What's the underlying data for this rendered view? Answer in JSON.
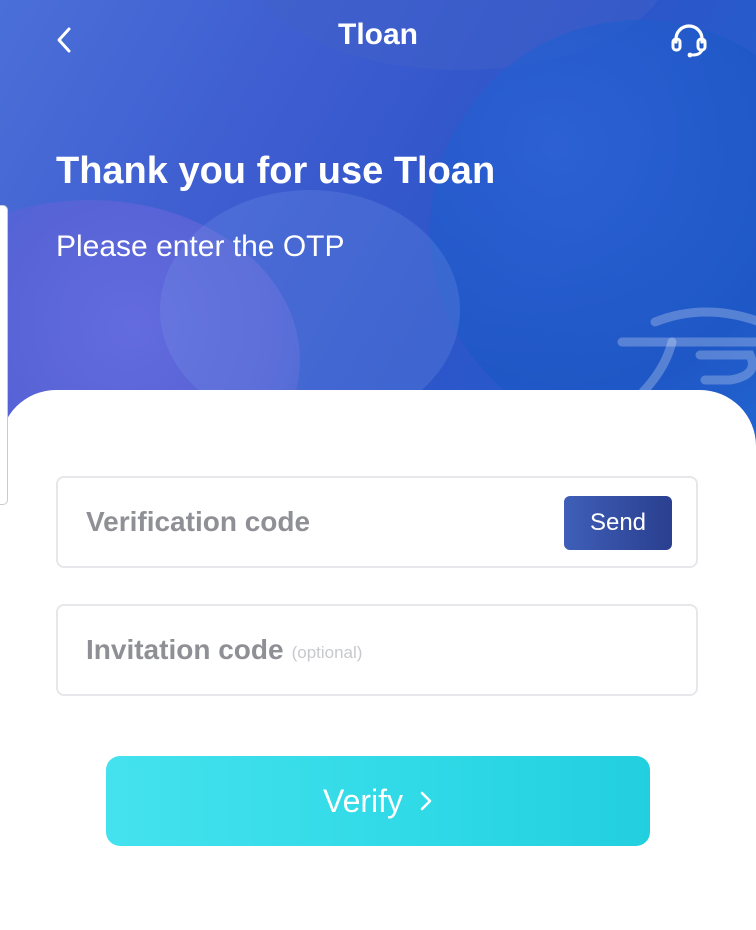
{
  "header": {
    "title": "Tloan",
    "back_icon": "chevron-left-icon",
    "support_icon": "headset-icon"
  },
  "intro": {
    "heading": "Thank you for use Tloan",
    "subheading": "Please enter the OTP"
  },
  "form": {
    "verification": {
      "placeholder": "Verification code",
      "value": "",
      "send_label": "Send"
    },
    "invitation": {
      "placeholder": "Invitation code",
      "optional_label": "(optional)",
      "value": ""
    },
    "verify_label": "Verify",
    "verify_icon": "chevron-right-icon"
  },
  "colors": {
    "hero_start": "#4b6fd8",
    "hero_end": "#1f63cf",
    "send_button": "#2a3f8f",
    "verify_button": "#2fd9e6",
    "placeholder_text": "#8f9095"
  }
}
